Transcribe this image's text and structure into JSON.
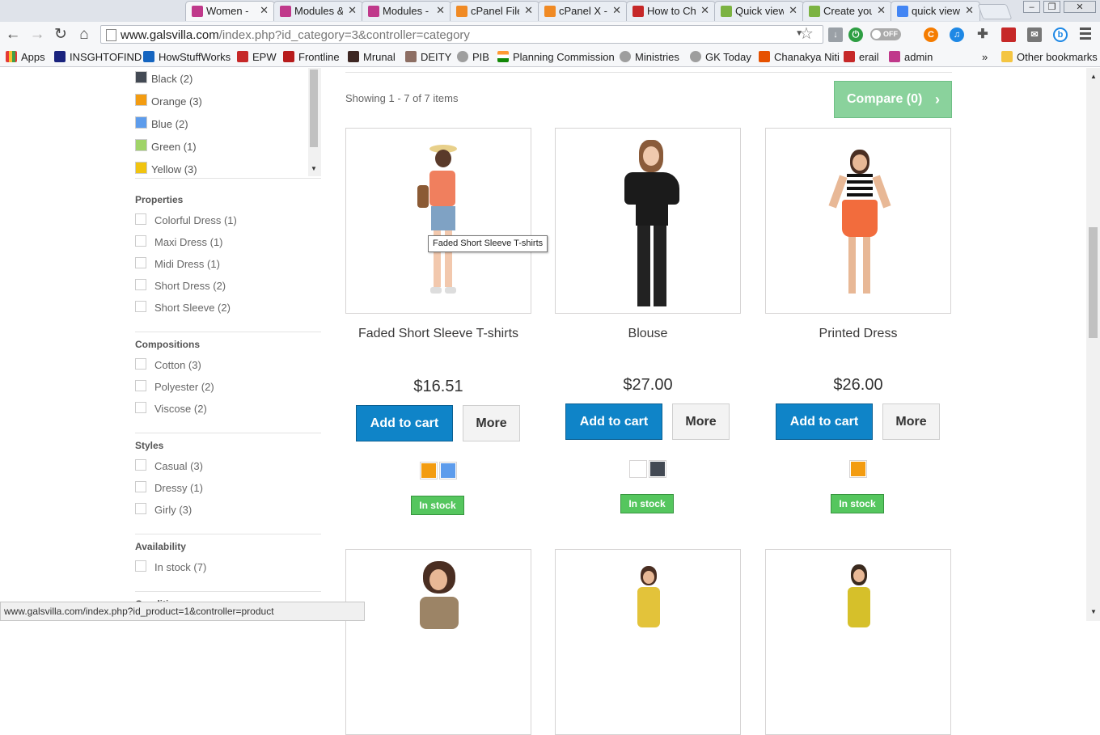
{
  "browser": {
    "tabs": [
      {
        "title": "Women -",
        "icon_color": "#c0398b"
      },
      {
        "title": "Modules &",
        "icon_color": "#c0398b"
      },
      {
        "title": "Modules -",
        "icon_color": "#c0398b"
      },
      {
        "title": "cPanel File",
        "icon_color": "#f08a24"
      },
      {
        "title": "cPanel X -",
        "icon_color": "#f08a24"
      },
      {
        "title": "How to Ch",
        "icon_color": "#c62828"
      },
      {
        "title": "Quick view",
        "icon_color": "#7cb342"
      },
      {
        "title": "Create you",
        "icon_color": "#7cb342"
      },
      {
        "title": "quick view",
        "icon_color": "#4285f4"
      }
    ],
    "url_host": "www.galsvilla.com",
    "url_path": "/index.php?id_category=3&controller=category",
    "toggle_label": "OFF",
    "bookmarks": [
      "Apps",
      "INSGHTOFIND",
      "HowStuffWorks",
      "EPW",
      "Frontline",
      "Mrunal",
      "DEITY",
      "PIB",
      "Planning Commission",
      "Ministries",
      "GK Today",
      "Chanakya Niti",
      "erail",
      "admin"
    ],
    "bookmarks_overflow": "»",
    "other_bookmarks": "Other bookmarks",
    "status_url": "www.galsvilla.com/index.php?id_product=1&controller=product"
  },
  "filters": {
    "colors": [
      {
        "label": "Black (2)",
        "color": "#434a54"
      },
      {
        "label": "Orange (3)",
        "color": "#f39c11"
      },
      {
        "label": "Blue (2)",
        "color": "#5d9cec"
      },
      {
        "label": "Green (1)",
        "color": "#a0d468"
      },
      {
        "label": "Yellow (3)",
        "color": "#f1c40f"
      }
    ],
    "properties": {
      "title": "Properties",
      "options": [
        "Colorful Dress (1)",
        "Maxi Dress (1)",
        "Midi Dress (1)",
        "Short Dress (2)",
        "Short Sleeve (2)"
      ]
    },
    "compositions": {
      "title": "Compositions",
      "options": [
        "Cotton (3)",
        "Polyester (2)",
        "Viscose (2)"
      ]
    },
    "styles": {
      "title": "Styles",
      "options": [
        "Casual (3)",
        "Dressy (1)",
        "Girly (3)"
      ]
    },
    "availability": {
      "title": "Availability",
      "options": [
        "In stock (7)"
      ]
    },
    "condition": {
      "title": "Condition"
    }
  },
  "listing": {
    "showing": "Showing 1 - 7 of 7 items",
    "compare_label": "Compare (0)",
    "tooltip": "Faded Short Sleeve T-shirts",
    "add_to_cart": "Add to cart",
    "more": "More",
    "in_stock": "In stock",
    "products": [
      {
        "name": "Faded Short Sleeve T-shirts",
        "price": "$16.51",
        "colors": [
          "#f39c11",
          "#5d9cec"
        ]
      },
      {
        "name": "Blouse",
        "price": "$27.00",
        "colors": [
          "#ffffff",
          "#434a54"
        ]
      },
      {
        "name": "Printed Dress",
        "price": "$26.00",
        "colors": [
          "#f39c11"
        ]
      }
    ]
  }
}
